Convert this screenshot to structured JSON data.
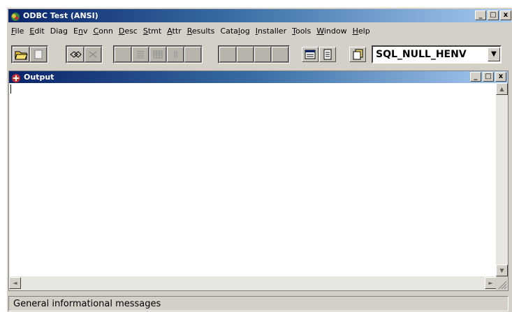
{
  "window": {
    "title": "ODBC Test (ANSI)"
  },
  "title_buttons": {
    "minimize": "_",
    "maximize": "□",
    "close": "x"
  },
  "menu": [
    {
      "pre": "",
      "u": "F",
      "post": "ile"
    },
    {
      "pre": "",
      "u": "E",
      "post": "dit"
    },
    {
      "pre": "Dia",
      "u": "g",
      "post": ""
    },
    {
      "pre": "E",
      "u": "n",
      "post": "v"
    },
    {
      "pre": "",
      "u": "C",
      "post": "onn"
    },
    {
      "pre": "",
      "u": "D",
      "post": "esc"
    },
    {
      "pre": "",
      "u": "S",
      "post": "tmt"
    },
    {
      "pre": "",
      "u": "A",
      "post": "ttr"
    },
    {
      "pre": "",
      "u": "R",
      "post": "esults"
    },
    {
      "pre": "Cata",
      "u": "l",
      "post": "og"
    },
    {
      "pre": "",
      "u": "I",
      "post": "nstaller"
    },
    {
      "pre": "",
      "u": "T",
      "post": "ools"
    },
    {
      "pre": "",
      "u": "W",
      "post": "indow"
    },
    {
      "pre": "",
      "u": "H",
      "post": "elp"
    }
  ],
  "toolbar": {
    "handle_combo_value": "SQL_NULL_HENV",
    "combo_arrow": "▼"
  },
  "output": {
    "title": "Output",
    "buttons": {
      "minimize": "_",
      "maximize": "□",
      "close": "x"
    }
  },
  "scroll": {
    "up": "▲",
    "down": "▼",
    "left": "◄",
    "right": "►"
  },
  "status": {
    "text": "General informational messages"
  }
}
